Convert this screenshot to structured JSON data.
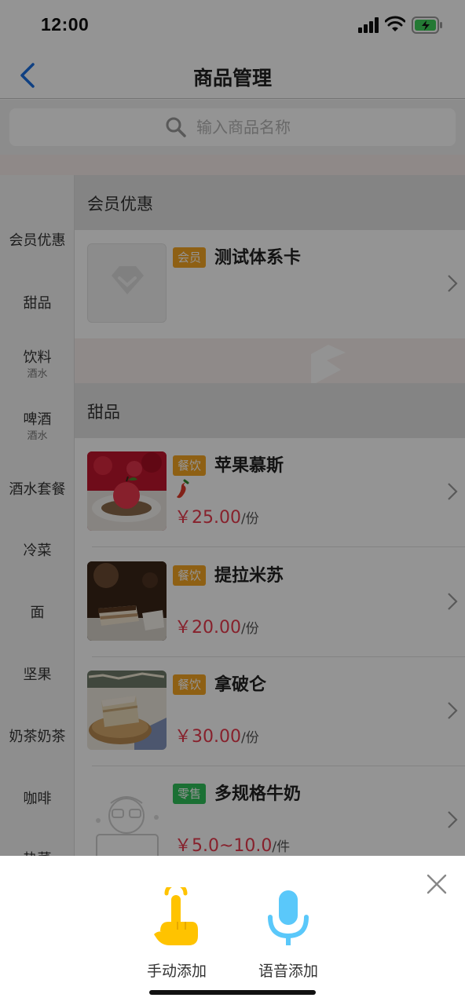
{
  "status": {
    "time": "12:00"
  },
  "nav": {
    "title": "商品管理"
  },
  "search": {
    "placeholder": "输入商品名称"
  },
  "categories": [
    {
      "name": "会员优惠",
      "sub": ""
    },
    {
      "name": "甜品",
      "sub": ""
    },
    {
      "name": "饮料",
      "sub": "酒水"
    },
    {
      "name": "啤酒",
      "sub": "酒水"
    },
    {
      "name": "酒水套餐",
      "sub": ""
    },
    {
      "name": "冷菜",
      "sub": ""
    },
    {
      "name": "面",
      "sub": ""
    },
    {
      "name": "坚果",
      "sub": ""
    },
    {
      "name": "奶茶奶茶",
      "sub": ""
    },
    {
      "name": "咖啡",
      "sub": ""
    },
    {
      "name": "热菜",
      "sub": ""
    }
  ],
  "sections": [
    {
      "title": "会员优惠",
      "items": [
        {
          "tag": "会员",
          "tag_color": "#f5a623",
          "name": "测试体系卡",
          "price": "",
          "unit": ""
        }
      ]
    },
    {
      "title": "甜品",
      "items": [
        {
          "tag": "餐饮",
          "tag_color": "#f5a623",
          "name": "苹果慕斯",
          "price": "￥25.00",
          "unit": "/份",
          "spicy": true
        },
        {
          "tag": "餐饮",
          "tag_color": "#f5a623",
          "name": "提拉米苏",
          "price": "￥20.00",
          "unit": "/份"
        },
        {
          "tag": "餐饮",
          "tag_color": "#f5a623",
          "name": "拿破仑",
          "price": "￥30.00",
          "unit": "/份"
        },
        {
          "tag": "零售",
          "tag_color": "#2fc25b",
          "name": "多规格牛奶",
          "price": "￥5.0~10.0",
          "unit": "/件"
        }
      ]
    }
  ],
  "sheet": {
    "manual_label": "手动添加",
    "voice_label": "语音添加",
    "accent_color": "#ffc300",
    "voice_color": "#5ac8fa"
  }
}
